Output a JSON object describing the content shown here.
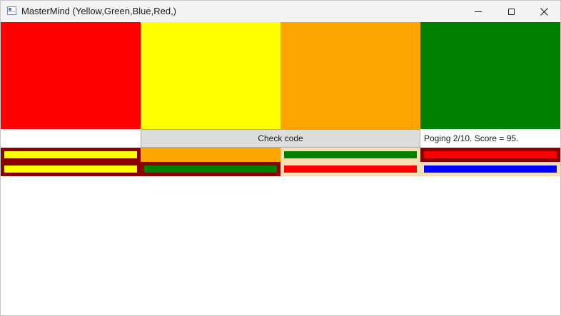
{
  "window": {
    "title": "MasterMind (Yellow,Green,Blue,Red,)",
    "icon": "app-window-icon"
  },
  "guess": {
    "pegs": [
      {
        "color": "#ff0000"
      },
      {
        "color": "#ffff00"
      },
      {
        "color": "#ffa500"
      },
      {
        "color": "#008000"
      }
    ]
  },
  "controls": {
    "check_label": "Check code",
    "status": "Poging 2/10. Score = 95."
  },
  "history": [
    {
      "cells": [
        {
          "peg": "#ffff00",
          "border": "#8b0000"
        },
        {
          "peg": "#ffa500",
          "border": "#ffa500"
        },
        {
          "peg": "#008000",
          "border": "#f5deb3"
        },
        {
          "peg": "#ff0000",
          "border": "#8b0000"
        }
      ]
    },
    {
      "cells": [
        {
          "peg": "#ffff00",
          "border": "#8b0000"
        },
        {
          "peg": "#008000",
          "border": "#8b0000"
        },
        {
          "peg": "#ff0000",
          "border": "#f5deb3"
        },
        {
          "peg": "#0000ff",
          "border": "#f5deb3"
        }
      ]
    }
  ]
}
